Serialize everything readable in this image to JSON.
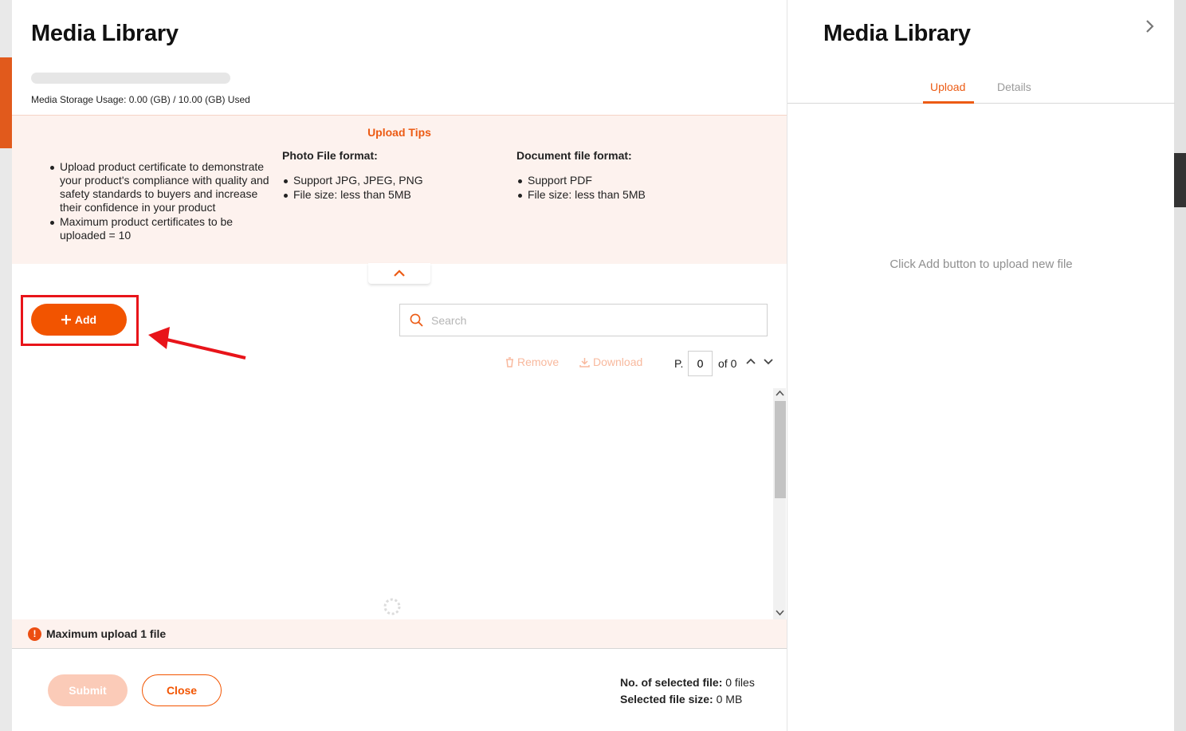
{
  "modal": {
    "title": "Media Library",
    "storage": {
      "usage_text": "Media Storage Usage: 0.00 (GB) / 10.00 (GB) Used",
      "used_fraction": 0.0
    },
    "tips": {
      "title": "Upload Tips",
      "general": [
        "Upload product certificate to demonstrate your product's compliance with quality and safety standards to buyers and increase their confidence in your product",
        "Maximum product certificates to be uploaded = 10"
      ],
      "photo": {
        "heading": "Photo File format:",
        "items": [
          "Support JPG, JPEG, PNG",
          "File size: less than 5MB"
        ]
      },
      "document": {
        "heading": "Document file format:",
        "items": [
          "Support PDF",
          "File size: less than 5MB"
        ]
      }
    },
    "add_label": "Add",
    "search_placeholder": "Search",
    "toolbar": {
      "remove_label": "Remove",
      "download_label": "Download"
    },
    "pager": {
      "prefix": "P.",
      "current": "0",
      "total_text": "of 0"
    },
    "warning": "Maximum upload 1 file",
    "submit_label": "Submit",
    "close_label": "Close",
    "summary": {
      "selected_files_label": "No. of selected file:",
      "selected_files_value": "0 files",
      "selected_size_label": "Selected file size:",
      "selected_size_value": "0 MB"
    }
  },
  "panel": {
    "title": "Media Library",
    "tabs": [
      {
        "label": "Upload",
        "active": true
      },
      {
        "label": "Details",
        "active": false
      }
    ],
    "empty_message": "Click Add button to upload new file"
  },
  "colors": {
    "accent": "#f25400",
    "highlight": "#e8141a",
    "tips_bg": "#fdf2ee"
  },
  "icons": [
    "plus-icon",
    "search-icon",
    "trash-icon",
    "download-icon",
    "chevron-up-icon",
    "chevron-down-icon",
    "chevron-right-icon",
    "alert-icon",
    "spinner-icon"
  ]
}
